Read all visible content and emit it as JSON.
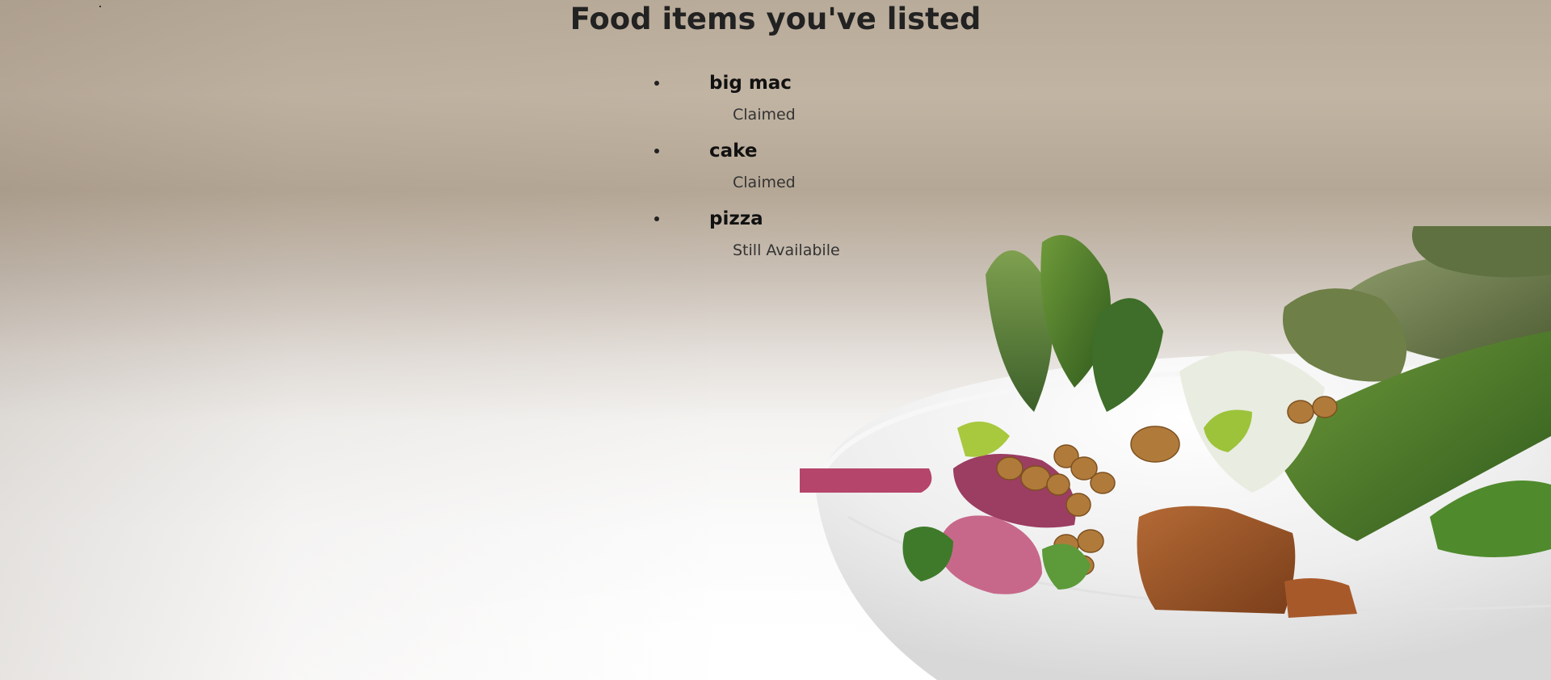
{
  "page": {
    "title": "Food items you've listed"
  },
  "food_items": [
    {
      "name": "big mac",
      "status": "Claimed"
    },
    {
      "name": "cake",
      "status": "Claimed"
    },
    {
      "name": "pizza",
      "status": "Still Availabile"
    }
  ],
  "background": {
    "image": "salad-bowl-photo",
    "top_tone": "#bfb1a0",
    "bottom_tone": "#ffffff"
  }
}
